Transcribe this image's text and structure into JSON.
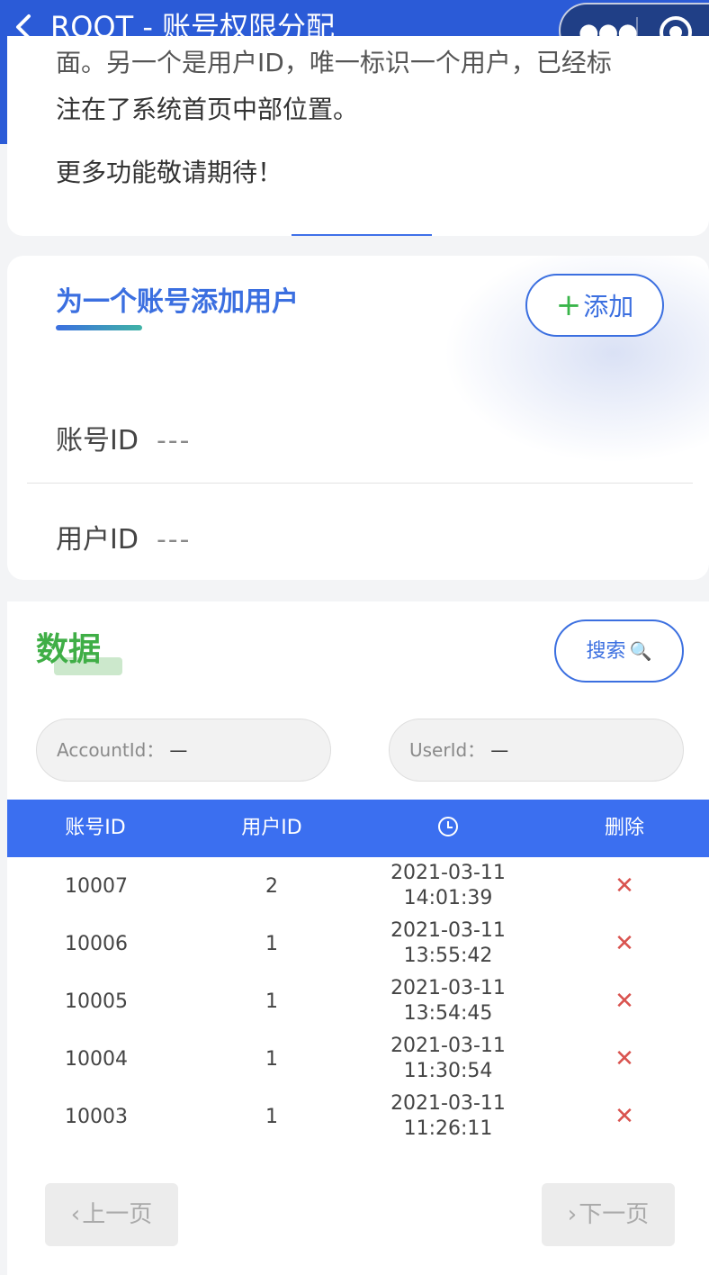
{
  "header": {
    "title": "ROOT - 账号权限分配"
  },
  "intro": {
    "lines": [
      "面。另一个是用户ID，唯一标识一个用户，已经标",
      "注在了系统首页中部位置。",
      "更多功能敬请期待！"
    ]
  },
  "add_user": {
    "title": "为一个账号添加用户",
    "add_button": "添加",
    "account_label": "账号ID",
    "account_value": "---",
    "user_label": "用户ID",
    "user_value": "---"
  },
  "data": {
    "title": "数据",
    "search_button": "搜索",
    "filters": {
      "account_label": "AccountId：",
      "account_value": "—",
      "user_label": "UserId：",
      "user_value": "—"
    },
    "columns": [
      "账号ID",
      "用户ID",
      "clock-icon",
      "删除"
    ],
    "rows": [
      {
        "account": "10007",
        "user": "2",
        "date": "2021-03-11",
        "time": "14:01:39"
      },
      {
        "account": "10006",
        "user": "1",
        "date": "2021-03-11",
        "time": "13:55:42"
      },
      {
        "account": "10005",
        "user": "1",
        "date": "2021-03-11",
        "time": "13:54:45"
      },
      {
        "account": "10004",
        "user": "1",
        "date": "2021-03-11",
        "time": "11:30:54"
      },
      {
        "account": "10003",
        "user": "1",
        "date": "2021-03-11",
        "time": "11:26:11"
      }
    ],
    "delete_symbol": "✕",
    "prev_label": "上一页",
    "next_label": "下一页"
  },
  "colors": {
    "header_bg": "#2b5bd7",
    "accent_blue": "#3b6fe0",
    "table_header": "#3b6ff0",
    "green": "#3fae46",
    "delete_red": "#d9534f"
  }
}
